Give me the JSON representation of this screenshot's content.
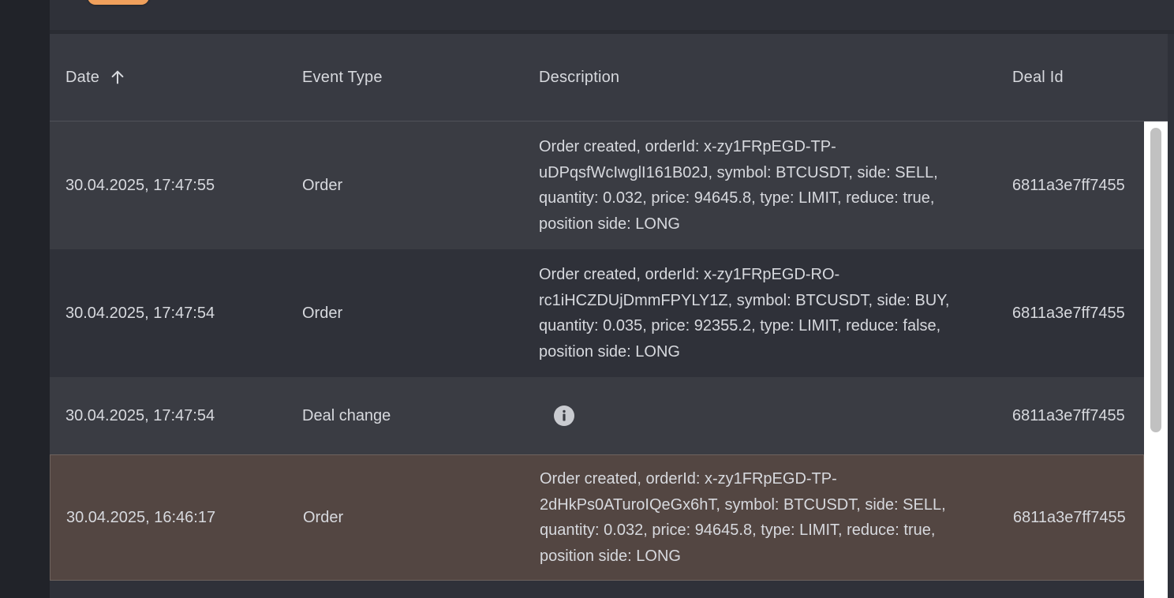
{
  "table": {
    "columns": {
      "date": "Date",
      "event_type": "Event Type",
      "description": "Description",
      "deal_id": "Deal Id"
    },
    "sort": {
      "column": "date",
      "direction": "ascending",
      "icon": "arrow-up-icon"
    },
    "rows": [
      {
        "date": "30.04.2025, 17:47:55",
        "event_type": "Order",
        "description": "Order created, orderId: x-zy1FRpEGD-TP-uDPqsfWcIwglI161B02J, symbol: BTCUSDT, side: SELL, quantity: 0.032, price: 94645.8, type: LIMIT, reduce: true, position side: LONG",
        "deal_id": "6811a3e7ff7455"
      },
      {
        "date": "30.04.2025, 17:47:54",
        "event_type": "Order",
        "description": "Order created, orderId: x-zy1FRpEGD-RO-rc1iHCZDUjDmmFPYLY1Z, symbol: BTCUSDT, side: BUY, quantity: 0.035, price: 92355.2, type: LIMIT, reduce: false, position side: LONG",
        "deal_id": "6811a3e7ff7455"
      },
      {
        "date": "30.04.2025, 17:47:54",
        "event_type": "Deal change",
        "description_icon": "info-icon",
        "deal_id": "6811a3e7ff7455"
      },
      {
        "date": "30.04.2025, 16:46:17",
        "event_type": "Order",
        "description": "Order created, orderId: x-zy1FRpEGD-TP-2dHkPs0ATuroIQeGx6hT, symbol: BTCUSDT, side: SELL, quantity: 0.032, price: 94645.8, type: LIMIT, reduce: true, position side: LONG",
        "deal_id": "6811a3e7ff7455"
      }
    ]
  },
  "colors": {
    "accent_button": "#f0a05c",
    "highlighted_row": "#534642",
    "header_bg": "#383a42",
    "text": "#d7d9de"
  }
}
